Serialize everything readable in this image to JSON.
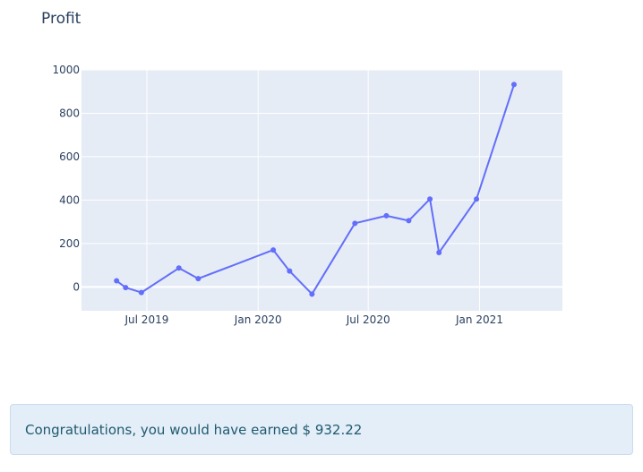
{
  "colors": {
    "plot_bg": "#e5ecf6",
    "grid": "#ffffff",
    "line": "#636efa",
    "text": "#2a3f5f",
    "alert_bg": "#e3eef8",
    "alert_text": "#1f5a6e"
  },
  "chart_data": {
    "type": "line",
    "title": "Profit",
    "xlabel": "",
    "ylabel": "",
    "x_tick_labels": [
      "Jul 2019",
      "Jan 2020",
      "Jul 2020",
      "Jan 2021"
    ],
    "x_tick_dates": [
      "2019-07-01",
      "2020-01-01",
      "2020-07-01",
      "2021-01-01"
    ],
    "xlim": [
      "2019-03-15",
      "2021-05-18"
    ],
    "y_ticks": [
      0,
      200,
      400,
      600,
      800,
      1000
    ],
    "ylim": [
      -110,
      1000
    ],
    "grid": true,
    "markers": true,
    "series": [
      {
        "x": [
          "2019-05-12",
          "2019-05-27",
          "2019-06-22",
          "2019-08-23",
          "2019-09-24",
          "2020-01-26",
          "2020-02-22",
          "2020-03-30",
          "2020-06-09",
          "2020-07-31",
          "2020-09-06",
          "2020-10-11",
          "2020-10-26",
          "2020-12-27",
          "2021-02-27"
        ],
        "values": [
          28,
          -3,
          -26,
          87,
          38,
          170,
          73,
          -33,
          293,
          328,
          305,
          405,
          158,
          405,
          932.22
        ]
      }
    ]
  },
  "alert": {
    "message": "Congratulations, you would have earned $ 932.22"
  }
}
